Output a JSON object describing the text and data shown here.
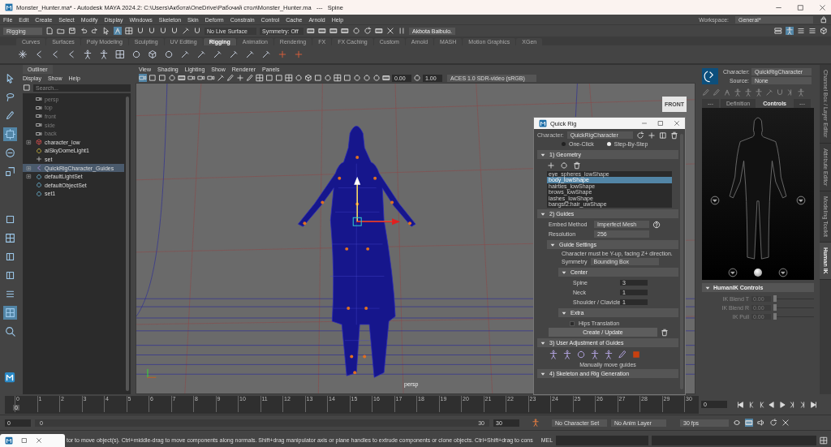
{
  "window": {
    "title": "Monster_Hunter.ma* - Autodesk MAYA 2024.2: C:\\Users\\Акбота\\OneDrive\\Рабочий стол\\Monster_Hunter.ma   ---   Spine"
  },
  "menu": [
    "File",
    "Edit",
    "Create",
    "Select",
    "Modify",
    "Display",
    "Windows",
    "Skeleton",
    "Skin",
    "Deform",
    "Constrain",
    "Control",
    "Cache",
    "Arnold",
    "Help"
  ],
  "workspace": {
    "label": "Workspace:",
    "value": "General*"
  },
  "status_line": {
    "menu_set": "Rigging",
    "live_surface": "No Live Surface",
    "symmetry": "Symmetry: Off",
    "user": "Akbota Baibulo."
  },
  "shelf_tabs": [
    {
      "label": "Curves",
      "selected": false
    },
    {
      "label": "Surfaces",
      "selected": false
    },
    {
      "label": "Poly Modeling",
      "selected": false
    },
    {
      "label": "Sculpting",
      "selected": false
    },
    {
      "label": "UV Editing",
      "selected": false
    },
    {
      "label": "Rigging",
      "selected": true
    },
    {
      "label": "Animation",
      "selected": false
    },
    {
      "label": "Rendering",
      "selected": false
    },
    {
      "label": "FX",
      "selected": false
    },
    {
      "label": "FX Caching",
      "selected": false
    },
    {
      "label": "Custom",
      "selected": false
    },
    {
      "label": "Arnold",
      "selected": false
    },
    {
      "label": "MASH",
      "selected": false
    },
    {
      "label": "Motion Graphics",
      "selected": false
    },
    {
      "label": "XGen",
      "selected": false
    }
  ],
  "outliner": {
    "tab": "Outliner",
    "menu": [
      "Display",
      "Show",
      "Help"
    ],
    "search_placeholder": "Search...",
    "items": [
      {
        "label": "persp",
        "kind": "camera",
        "dimmed": true,
        "expandable": false,
        "selected": false
      },
      {
        "label": "top",
        "kind": "camera",
        "dimmed": true,
        "expandable": false,
        "selected": false
      },
      {
        "label": "front",
        "kind": "camera",
        "dimmed": true,
        "expandable": false,
        "selected": false
      },
      {
        "label": "side",
        "kind": "camera",
        "dimmed": true,
        "expandable": false,
        "selected": false
      },
      {
        "label": "back",
        "kind": "camera",
        "dimmed": true,
        "expandable": false,
        "selected": false
      },
      {
        "label": "character_low",
        "kind": "mesh",
        "dimmed": false,
        "expandable": true,
        "selected": false
      },
      {
        "label": "aiSkyDomeLight1",
        "kind": "light",
        "dimmed": false,
        "expandable": false,
        "selected": false
      },
      {
        "label": "set",
        "kind": "locator",
        "dimmed": false,
        "expandable": false,
        "selected": false
      },
      {
        "label": "QuickRigCharacter_Guides",
        "kind": "joint",
        "dimmed": false,
        "expandable": true,
        "selected": true
      },
      {
        "label": "defaultLightSet",
        "kind": "set",
        "dimmed": false,
        "expandable": true,
        "selected": false
      },
      {
        "label": "defaultObjectSet",
        "kind": "set",
        "dimmed": false,
        "expandable": false,
        "selected": false
      },
      {
        "label": "set1",
        "kind": "set",
        "dimmed": false,
        "expandable": false,
        "selected": false
      }
    ]
  },
  "viewport": {
    "menu": [
      "View",
      "Shading",
      "Lighting",
      "Show",
      "Renderer",
      "Panels"
    ],
    "exposure": "0.00",
    "gamma": "1.00",
    "color_space": "ACES 1.0 SDR-video (sRGB)",
    "view_cube": "FRONT",
    "camera": "persp"
  },
  "quick_rig": {
    "title": "Quick Rig",
    "character_label": "Character:",
    "character": "QuickRigCharacter",
    "modes": [
      {
        "label": "One-Click",
        "selected": false
      },
      {
        "label": "Step-By-Step",
        "selected": true
      }
    ],
    "geometry": {
      "title": "1) Geometry",
      "meshes": [
        {
          "name": "eye_spheres_lowShape",
          "selected": false
        },
        {
          "name": "body_lowShape",
          "selected": true
        },
        {
          "name": "hairties_lowShape",
          "selected": false
        },
        {
          "name": "brows_lowShape",
          "selected": false
        },
        {
          "name": "lashes_lowShape",
          "selected": false
        },
        {
          "name": "bangsf2:hair_uwShape",
          "selected": false
        }
      ]
    },
    "guides": {
      "title": "2) Guides",
      "embed_label": "Embed Method",
      "embed_method": "Imperfect Mesh",
      "resolution_label": "Resolution",
      "resolution": "256",
      "settings_title": "Guide Settings",
      "note": "Character must be Y-up, facing Z+ direction.",
      "symmetry_label": "Symmetry",
      "symmetry": "Bounding Box",
      "center_title": "Center",
      "center_fields": [
        {
          "label": "Spine",
          "value": "3"
        },
        {
          "label": "Neck",
          "value": "1"
        },
        {
          "label": "Shoulder / Clavicle",
          "value": "1"
        }
      ],
      "extra_title": "Extra",
      "hips": {
        "label": "Hips Translation",
        "checked": false
      },
      "button": "Create / Update"
    },
    "adjust": {
      "title": "3) User Adjustment of Guides",
      "caption": "Manually move guides"
    },
    "skeleton": {
      "title": "4) Skeleton and Rig Generation"
    }
  },
  "human_ik": {
    "character_label": "Character:",
    "character": "QuickRigCharacter",
    "source_label": "Source:",
    "source": "None",
    "tabs": [
      {
        "label": "---",
        "selected": false
      },
      {
        "label": "Definition",
        "selected": false
      },
      {
        "label": "Controls",
        "selected": true
      },
      {
        "label": "---",
        "selected": false
      }
    ],
    "controls_title": "HumanIK Controls",
    "sliders": [
      {
        "label": "IK Blend T",
        "reading": "0.00",
        "level": 0
      },
      {
        "label": "IK Blend R",
        "reading": "0.00",
        "level": 0
      },
      {
        "label": "IK Pull",
        "reading": "0.00",
        "level": 0
      }
    ]
  },
  "side_tabs": [
    {
      "label": "Channel Box / Layer Editor",
      "selected": false
    },
    {
      "label": "Attribute Editor",
      "selected": false
    },
    {
      "label": "Modeling Toolkit",
      "selected": false
    },
    {
      "label": "Human IK",
      "selected": true
    }
  ],
  "timeline": {
    "frames": [
      "0",
      "1",
      "2",
      "3",
      "4",
      "5",
      "6",
      "7",
      "8",
      "9",
      "10",
      "11",
      "12",
      "13",
      "14",
      "15",
      "16",
      "17",
      "18",
      "19",
      "20",
      "21",
      "22",
      "23",
      "24",
      "25",
      "26",
      "27",
      "28",
      "29",
      "30"
    ],
    "current_frame": "0",
    "level": 0,
    "frame_field": "0"
  },
  "range": {
    "start": "0",
    "slider_start": "0",
    "slider_end": "30",
    "level": 1,
    "end": "30",
    "character_set": "No Character Set",
    "anim_layer": "No Anim Layer",
    "fps": "30 fps"
  },
  "help_line": {
    "text": "tor to move object(s). Ctrl+middle-drag to move components along normals. Shift+drag manipulator axis or plane handles to extrude components or clone objects. Ctrl+Shift+drag to cons",
    "mel_label": "MEL"
  }
}
